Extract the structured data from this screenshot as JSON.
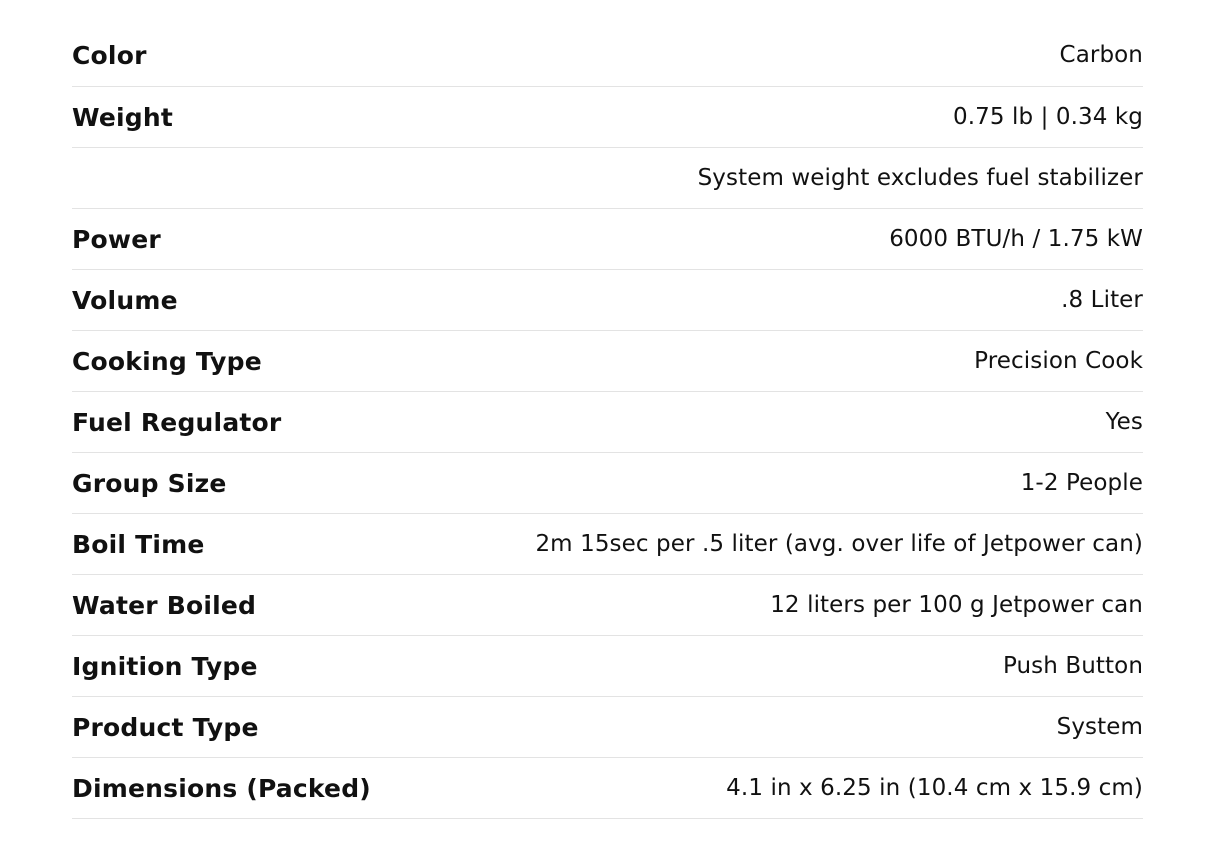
{
  "specs": {
    "rows": [
      {
        "label": "Color",
        "value": "Carbon"
      },
      {
        "label": "Weight",
        "value": "0.75 lb | 0.34 kg"
      },
      {
        "label": "",
        "value": "System weight excludes fuel stabilizer"
      },
      {
        "label": "Power",
        "value": "6000 BTU/h / 1.75 kW"
      },
      {
        "label": "Volume",
        "value": ".8 Liter"
      },
      {
        "label": "Cooking Type",
        "value": "Precision Cook"
      },
      {
        "label": "Fuel Regulator",
        "value": "Yes"
      },
      {
        "label": "Group Size",
        "value": "1-2 People"
      },
      {
        "label": "Boil Time",
        "value": "2m 15sec per .5 liter (avg. over life of Jetpower can)"
      },
      {
        "label": "Water Boiled",
        "value": "12 liters per 100 g Jetpower can"
      },
      {
        "label": "Ignition Type",
        "value": "Push Button"
      },
      {
        "label": "Product Type",
        "value": "System"
      },
      {
        "label": "Dimensions (Packed)",
        "value": "4.1 in x 6.25 in (10.4 cm x 15.9 cm)"
      }
    ]
  }
}
